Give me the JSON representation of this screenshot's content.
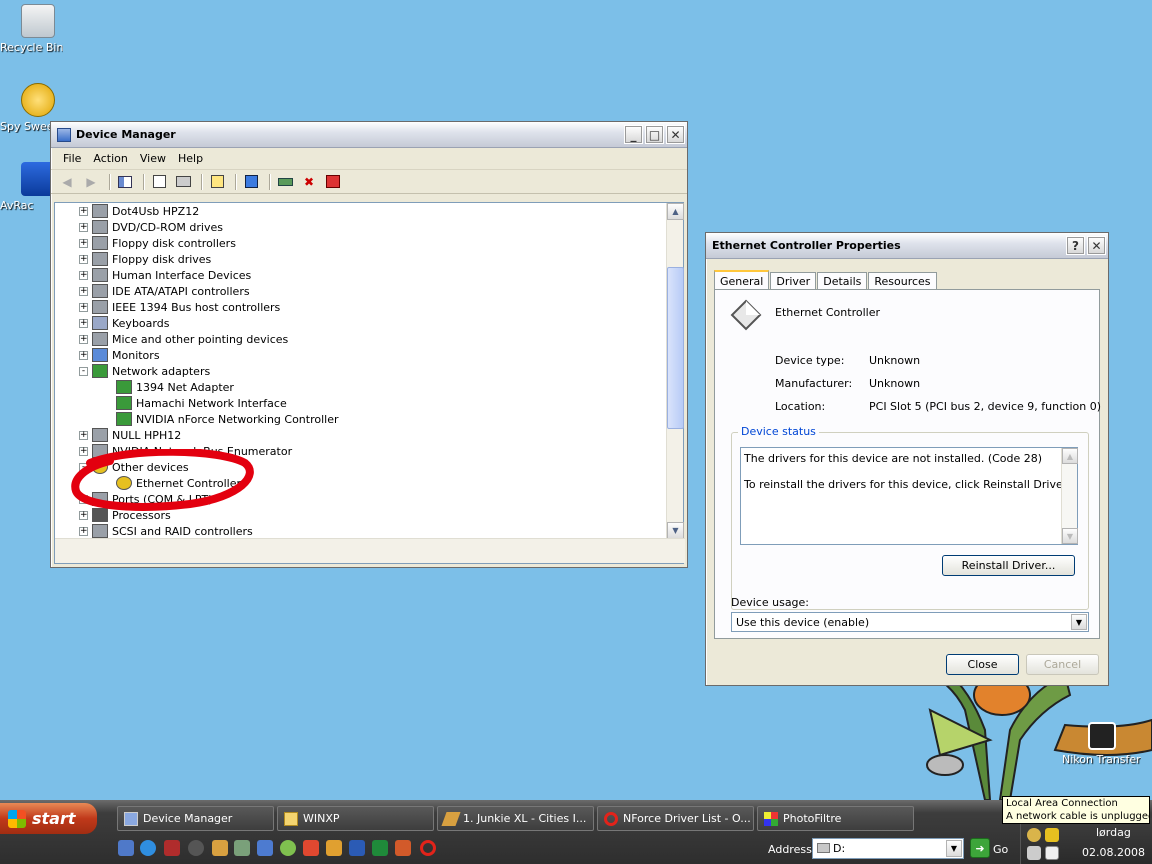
{
  "desktop": {
    "icons": [
      {
        "label": "Recycle Bin",
        "icon": "recycle-bin-icon"
      },
      {
        "label": "Spy Swee",
        "icon": "spy-sweeper-icon"
      },
      {
        "label": "AvRac",
        "icon": "avrack-icon"
      },
      {
        "label": "Nikon Transfer",
        "icon": "nikon-transfer-icon"
      }
    ]
  },
  "device_manager": {
    "title": "Device Manager",
    "menu": [
      "File",
      "Action",
      "View",
      "Help"
    ],
    "toolbar_icons": [
      "back-arrow-icon",
      "forward-arrow-icon",
      "show-hide-console-tree-icon",
      "properties-icon",
      "print-icon",
      "help-icon",
      "scan-hardware-icon",
      "update-driver-icon",
      "disable-device-icon",
      "uninstall-device-icon"
    ],
    "tree": [
      {
        "label": "Dot4Usb HPZ12",
        "level": 0,
        "expander": "+"
      },
      {
        "label": "DVD/CD-ROM drives",
        "level": 0,
        "expander": "+"
      },
      {
        "label": "Floppy disk controllers",
        "level": 0,
        "expander": "+"
      },
      {
        "label": "Floppy disk drives",
        "level": 0,
        "expander": "+"
      },
      {
        "label": "Human Interface Devices",
        "level": 0,
        "expander": "+"
      },
      {
        "label": "IDE ATA/ATAPI controllers",
        "level": 0,
        "expander": "+"
      },
      {
        "label": "IEEE 1394 Bus host controllers",
        "level": 0,
        "expander": "+"
      },
      {
        "label": "Keyboards",
        "level": 0,
        "expander": "+"
      },
      {
        "label": "Mice and other pointing devices",
        "level": 0,
        "expander": "+"
      },
      {
        "label": "Monitors",
        "level": 0,
        "expander": "+"
      },
      {
        "label": "Network adapters",
        "level": 0,
        "expander": "-"
      },
      {
        "label": "1394 Net Adapter",
        "level": 1,
        "expander": ""
      },
      {
        "label": "Hamachi Network Interface",
        "level": 1,
        "expander": ""
      },
      {
        "label": "NVIDIA nForce Networking Controller",
        "level": 1,
        "expander": ""
      },
      {
        "label": "NULL HPH12",
        "level": 0,
        "expander": "+"
      },
      {
        "label": "NVIDIA Network Bus Enumerator",
        "level": 0,
        "expander": "+"
      },
      {
        "label": "Other devices",
        "level": 0,
        "expander": "-"
      },
      {
        "label": "Ethernet Controller",
        "level": 1,
        "expander": ""
      },
      {
        "label": "Ports (COM & LPT)",
        "level": 0,
        "expander": "+"
      },
      {
        "label": "Processors",
        "level": 0,
        "expander": "+"
      },
      {
        "label": "SCSI and RAID controllers",
        "level": 0,
        "expander": "+"
      }
    ]
  },
  "properties": {
    "title": "Ethernet Controller Properties",
    "tabs": [
      "General",
      "Driver",
      "Details",
      "Resources"
    ],
    "device_name": "Ethernet Controller",
    "fields": [
      {
        "label": "Device type:",
        "value": "Unknown"
      },
      {
        "label": "Manufacturer:",
        "value": "Unknown"
      },
      {
        "label": "Location:",
        "value": "PCI Slot 5 (PCI bus 2, device 9, function 0)"
      }
    ],
    "status_group": "Device status",
    "status_line1": "The drivers for this device are not installed. (Code 28)",
    "status_line2": "To reinstall the drivers for this device, click Reinstall Driver.",
    "reinstall_label": "Reinstall Driver...",
    "usage_label": "Device usage:",
    "usage_value": "Use this device (enable)",
    "close_label": "Close",
    "cancel_label": "Cancel"
  },
  "taskbar": {
    "start_label": "start",
    "tasks": [
      {
        "label": "Device Manager",
        "icon": "device-manager-icon"
      },
      {
        "label": "WINXP",
        "icon": "folder-icon"
      },
      {
        "label": "1. Junkie XL - Cities I...",
        "icon": "winamp-icon"
      },
      {
        "label": "NForce Driver List - O...",
        "icon": "opera-icon"
      },
      {
        "label": "PhotoFiltre",
        "icon": "photofiltre-icon"
      }
    ],
    "address_label": "Address",
    "address_value": "D:",
    "go_label": "Go",
    "balloon_line1": "Local Area Connection",
    "balloon_line2": "A network cable is unplugged.",
    "day": "lørdag",
    "date": "02.08.2008"
  }
}
